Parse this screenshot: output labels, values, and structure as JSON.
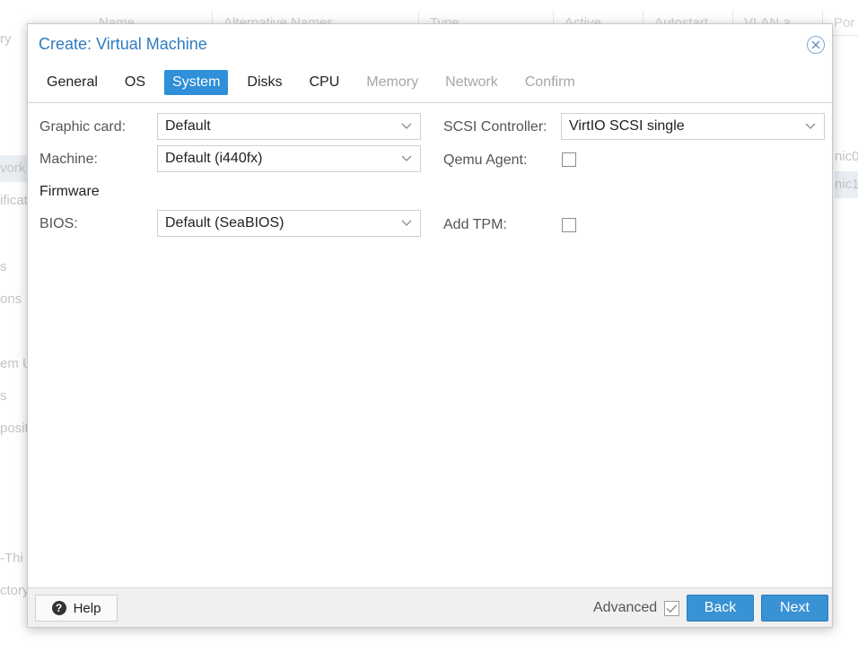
{
  "background": {
    "left_items": [
      "ry",
      "vork",
      "ificat",
      "s",
      "ons",
      "em U",
      "s",
      "posito",
      "-Thi",
      "ctory"
    ],
    "columns": [
      "Name",
      "Alternative Names",
      "Type",
      "Active",
      "Autostart",
      "VLAN a...",
      "Por"
    ],
    "right_cells": [
      "nic0",
      "nic1"
    ]
  },
  "dialog": {
    "title": "Create: Virtual Machine",
    "tabs": [
      {
        "label": "General",
        "state": "normal"
      },
      {
        "label": "OS",
        "state": "normal"
      },
      {
        "label": "System",
        "state": "active"
      },
      {
        "label": "Disks",
        "state": "normal"
      },
      {
        "label": "CPU",
        "state": "normal"
      },
      {
        "label": "Memory",
        "state": "disabled"
      },
      {
        "label": "Network",
        "state": "disabled"
      },
      {
        "label": "Confirm",
        "state": "disabled"
      }
    ],
    "form": {
      "graphic_card": {
        "label": "Graphic card:",
        "value": "Default"
      },
      "machine": {
        "label": "Machine:",
        "value": "Default (i440fx)"
      },
      "firmware_heading": "Firmware",
      "bios": {
        "label": "BIOS:",
        "value": "Default (SeaBIOS)"
      },
      "scsi_controller": {
        "label": "SCSI Controller:",
        "value": "VirtIO SCSI single"
      },
      "qemu_agent": {
        "label": "Qemu Agent:",
        "checked": false
      },
      "add_tpm": {
        "label": "Add TPM:",
        "checked": false
      }
    },
    "footer": {
      "help_label": "Help",
      "advanced_label": "Advanced",
      "advanced_checked": true,
      "back_label": "Back",
      "next_label": "Next"
    }
  },
  "colors": {
    "accent": "#2f8fd8",
    "title": "#2f7bc0",
    "disabled_tab": "#a6a6a6"
  }
}
